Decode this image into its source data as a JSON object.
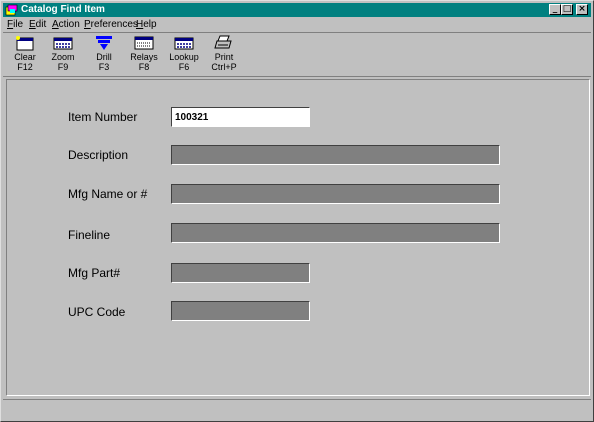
{
  "window": {
    "title": "Catalog Find Item",
    "app_icon": "catalog-icon"
  },
  "menu": [
    {
      "label": "File",
      "accel": "F",
      "rest": "ile"
    },
    {
      "label": "Edit",
      "accel": "E",
      "rest": "dit"
    },
    {
      "label": "Action",
      "accel": "A",
      "rest": "ction"
    },
    {
      "label": "Preferences",
      "accel": "P",
      "rest": "references"
    },
    {
      "label": "Help",
      "accel": "H",
      "rest": "elp"
    }
  ],
  "toolbar": [
    {
      "name": "clear",
      "label": "Clear",
      "key": "F12",
      "icon": "clear-icon"
    },
    {
      "name": "zoom",
      "label": "Zoom",
      "key": "F9",
      "icon": "zoom-icon"
    },
    {
      "name": "drill",
      "label": "Drill",
      "key": "F3",
      "icon": "drill-icon"
    },
    {
      "name": "relays",
      "label": "Relays",
      "key": "F8",
      "icon": "relays-icon"
    },
    {
      "name": "lookup",
      "label": "Lookup",
      "key": "F6",
      "icon": "lookup-icon"
    },
    {
      "name": "print",
      "label": "Print",
      "key": "Ctrl+P",
      "icon": "printer-icon"
    }
  ],
  "form": {
    "item_number": {
      "label": "Item Number",
      "value": "100321"
    },
    "description": {
      "label": "Description",
      "value": ""
    },
    "mfg_name": {
      "label": "Mfg Name or #",
      "value": ""
    },
    "fineline": {
      "label": "Fineline",
      "value": ""
    },
    "mfg_part": {
      "label": "Mfg Part#",
      "value": ""
    },
    "upc_code": {
      "label": "UPC Code",
      "value": ""
    }
  },
  "colors": {
    "titlebar": "#008080",
    "face": "#c0c0c0",
    "disabled_field": "#808080",
    "drill_icon": "#0000ff"
  }
}
